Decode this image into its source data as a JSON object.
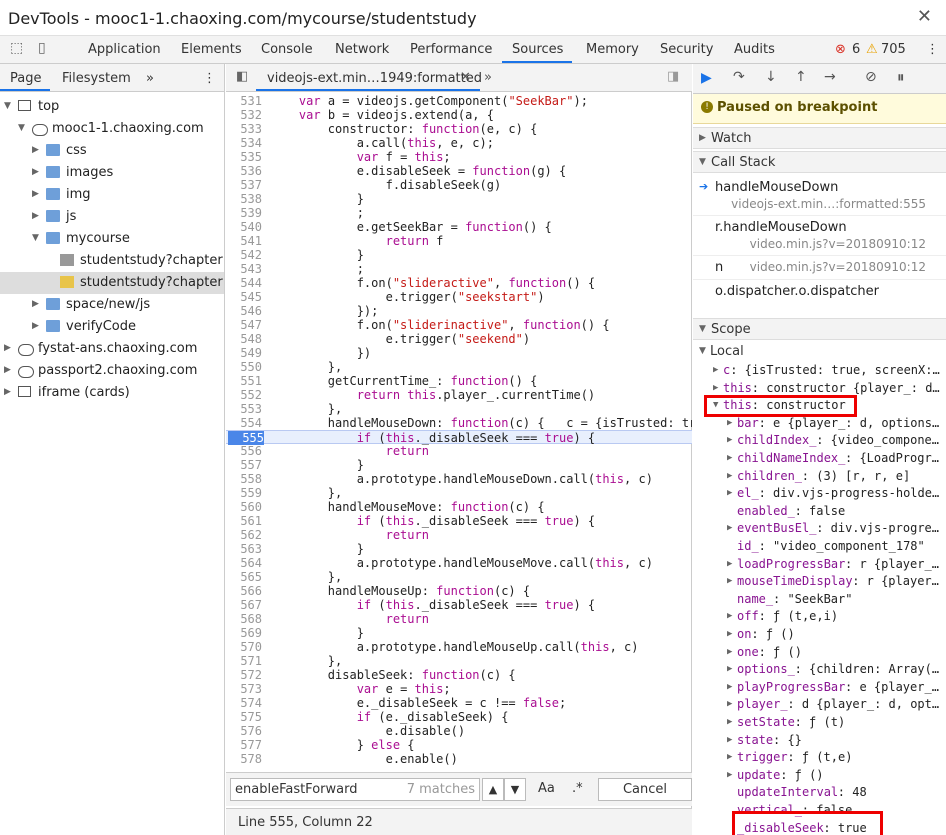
{
  "window": {
    "title": "DevTools - mooc1-1.chaoxing.com/mycourse/studentstudy"
  },
  "tabs": [
    "Application",
    "Elements",
    "Console",
    "Network",
    "Performance",
    "Sources",
    "Memory",
    "Security",
    "Audits"
  ],
  "active_tab": "Sources",
  "counts": {
    "errors": "6",
    "warnings": "705"
  },
  "navigator": {
    "tabs": [
      "Page",
      "Filesystem"
    ],
    "tree": [
      {
        "label": "top",
        "kind": "frame"
      },
      {
        "label": "mooc1-1.chaoxing.com",
        "kind": "cloud"
      },
      {
        "label": "css",
        "kind": "folder"
      },
      {
        "label": "images",
        "kind": "folder"
      },
      {
        "label": "img",
        "kind": "folder"
      },
      {
        "label": "js",
        "kind": "folder"
      },
      {
        "label": "mycourse",
        "kind": "folder"
      },
      {
        "label": "studentstudy?chapterId=",
        "kind": "file"
      },
      {
        "label": "studentstudy?chapterId=",
        "kind": "file"
      },
      {
        "label": "space/new/js",
        "kind": "folder"
      },
      {
        "label": "verifyCode",
        "kind": "folder"
      },
      {
        "label": "fystat-ans.chaoxing.com",
        "kind": "cloud"
      },
      {
        "label": "passport2.chaoxing.com",
        "kind": "cloud"
      },
      {
        "label": "iframe (cards)",
        "kind": "frame"
      }
    ]
  },
  "editor": {
    "file_tab": "videojs-ext.min…1949:formatted",
    "lines": [
      {
        "n": "531",
        "t": "    var a = videojs.getComponent(\"SeekBar\");"
      },
      {
        "n": "532",
        "t": "    var b = videojs.extend(a, {"
      },
      {
        "n": "533",
        "t": "        constructor: function(e, c) {"
      },
      {
        "n": "534",
        "t": "            a.call(this, e, c);"
      },
      {
        "n": "535",
        "t": "            var f = this;"
      },
      {
        "n": "536",
        "t": "            e.disableSeek = function(g) {"
      },
      {
        "n": "537",
        "t": "                f.disableSeek(g)"
      },
      {
        "n": "538",
        "t": "            }"
      },
      {
        "n": "539",
        "t": "            ;"
      },
      {
        "n": "540",
        "t": "            e.getSeekBar = function() {"
      },
      {
        "n": "541",
        "t": "                return f"
      },
      {
        "n": "542",
        "t": "            }"
      },
      {
        "n": "543",
        "t": "            ;"
      },
      {
        "n": "544",
        "t": "            f.on(\"slideractive\", function() {"
      },
      {
        "n": "545",
        "t": "                e.trigger(\"seekstart\")"
      },
      {
        "n": "546",
        "t": "            });"
      },
      {
        "n": "547",
        "t": "            f.on(\"sliderinactive\", function() {"
      },
      {
        "n": "548",
        "t": "                e.trigger(\"seekend\")"
      },
      {
        "n": "549",
        "t": "            })"
      },
      {
        "n": "550",
        "t": "        },"
      },
      {
        "n": "551",
        "t": "        getCurrentTime_: function() {"
      },
      {
        "n": "552",
        "t": "            return this.player_.currentTime()"
      },
      {
        "n": "553",
        "t": "        },"
      },
      {
        "n": "554",
        "t": "        handleMouseDown: function(c) {   c = {isTrusted: tr"
      },
      {
        "n": "555",
        "t": "            if (this._disableSeek === true) {"
      },
      {
        "n": "556",
        "t": "                return"
      },
      {
        "n": "557",
        "t": "            }"
      },
      {
        "n": "558",
        "t": "            a.prototype.handleMouseDown.call(this, c)"
      },
      {
        "n": "559",
        "t": "        },"
      },
      {
        "n": "560",
        "t": "        handleMouseMove: function(c) {"
      },
      {
        "n": "561",
        "t": "            if (this._disableSeek === true) {"
      },
      {
        "n": "562",
        "t": "                return"
      },
      {
        "n": "563",
        "t": "            }"
      },
      {
        "n": "564",
        "t": "            a.prototype.handleMouseMove.call(this, c)"
      },
      {
        "n": "565",
        "t": "        },"
      },
      {
        "n": "566",
        "t": "        handleMouseUp: function(c) {"
      },
      {
        "n": "567",
        "t": "            if (this._disableSeek === true) {"
      },
      {
        "n": "568",
        "t": "                return"
      },
      {
        "n": "569",
        "t": "            }"
      },
      {
        "n": "570",
        "t": "            a.prototype.handleMouseUp.call(this, c)"
      },
      {
        "n": "571",
        "t": "        },"
      },
      {
        "n": "572",
        "t": "        disableSeek: function(c) {"
      },
      {
        "n": "573",
        "t": "            var e = this;"
      },
      {
        "n": "574",
        "t": "            e._disableSeek = c !== false;"
      },
      {
        "n": "575",
        "t": "            if (e._disableSeek) {"
      },
      {
        "n": "576",
        "t": "                e.disable()"
      },
      {
        "n": "577",
        "t": "            } else {"
      },
      {
        "n": "578",
        "t": "                e.enable()"
      }
    ],
    "highlight_line": "555",
    "search": {
      "value": "enableFastForward",
      "matches": "7 matches",
      "case_label": "Aa",
      "regex_label": ".*",
      "cancel_label": "Cancel"
    },
    "status": "Line 555, Column 22"
  },
  "debugger": {
    "paused": "Paused on breakpoint",
    "watch": "Watch",
    "call_stack": "Call Stack",
    "frames": [
      {
        "name": "handleMouseDown",
        "file": "videojs-ext.min…:formatted:555"
      },
      {
        "name": "r.handleMouseDown",
        "file": "video.min.js?v=20180910:12"
      },
      {
        "name": "n",
        "file": "video.min.js?v=20180910:12"
      },
      {
        "name": "o.dispatcher.o.dispatcher",
        "file": ""
      }
    ],
    "scope": "Scope",
    "local": "Local",
    "scope_rows": [
      {
        "k": "c",
        "v": ": {isTrusted: true, screenX:…"
      },
      {
        "k": "this",
        "v": ": constructor {player_: d…"
      },
      {
        "k": "this",
        "v": ": constructor"
      },
      {
        "k": "bar",
        "v": ": e {player_: d, options…"
      },
      {
        "k": "childIndex_",
        "v": ": {video_compone…"
      },
      {
        "k": "childNameIndex_",
        "v": ": {LoadProgr…"
      },
      {
        "k": "children_",
        "v": ": (3) [r, r, e]"
      },
      {
        "k": "el_",
        "v": ": div.vjs-progress-holde…"
      },
      {
        "k": "enabled_",
        "v": ": false"
      },
      {
        "k": "eventBusEl_",
        "v": ": div.vjs-progre…"
      },
      {
        "k": "id_",
        "v": ": \"video_component_178\""
      },
      {
        "k": "loadProgressBar",
        "v": ": r {player_…"
      },
      {
        "k": "mouseTimeDisplay",
        "v": ": r {player…"
      },
      {
        "k": "name_",
        "v": ": \"SeekBar\""
      },
      {
        "k": "off",
        "v": ": ƒ (t,e,i)"
      },
      {
        "k": "on",
        "v": ": ƒ ()"
      },
      {
        "k": "one",
        "v": ": ƒ ()"
      },
      {
        "k": "options_",
        "v": ": {children: Array(…"
      },
      {
        "k": "playProgressBar",
        "v": ": e {player_…"
      },
      {
        "k": "player_",
        "v": ": d {player_: d, opt…"
      },
      {
        "k": "setState",
        "v": ": ƒ (t)"
      },
      {
        "k": "state",
        "v": ": {}"
      },
      {
        "k": "trigger",
        "v": ": ƒ (t,e)"
      },
      {
        "k": "update",
        "v": ": ƒ ()"
      },
      {
        "k": "updateInterval",
        "v": ": 48"
      },
      {
        "k": "vertical_",
        "v": ": false"
      },
      {
        "k": "_disableSeek",
        "v": ": true"
      }
    ]
  }
}
